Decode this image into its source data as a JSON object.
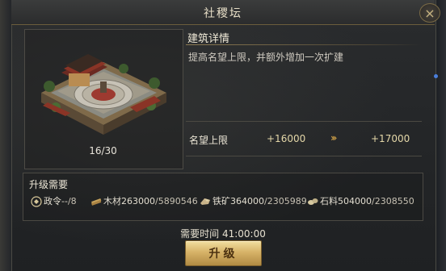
{
  "window": {
    "title": "社稷坛",
    "close_glyph": "×"
  },
  "building": {
    "level": "16/30"
  },
  "detail": {
    "title": "建筑详情",
    "description": "提高名望上限，并额外增加一次扩建",
    "stat": {
      "name": "名望上限",
      "current": "+16000",
      "arrow": "›››",
      "next": "+17000"
    }
  },
  "requirements": {
    "title": "升级需要",
    "items": [
      {
        "icon": "decree-icon",
        "name": "政令",
        "have": "--",
        "need": "/8"
      },
      {
        "icon": "wood-icon",
        "name": "木材",
        "have": "263000",
        "need": "/5890546"
      },
      {
        "icon": "iron-icon",
        "name": "铁矿",
        "have": "364000",
        "need": "/2305989"
      },
      {
        "icon": "stone-icon",
        "name": "石料",
        "have": "504000",
        "need": "/2308550"
      }
    ]
  },
  "time": {
    "text": "需要时间 41:00:00"
  },
  "upgrade_button": {
    "label": "升级"
  },
  "colors": {
    "accent_gold": "#d7b368",
    "panel": "#232527",
    "indicator": "#4a7fdc"
  }
}
